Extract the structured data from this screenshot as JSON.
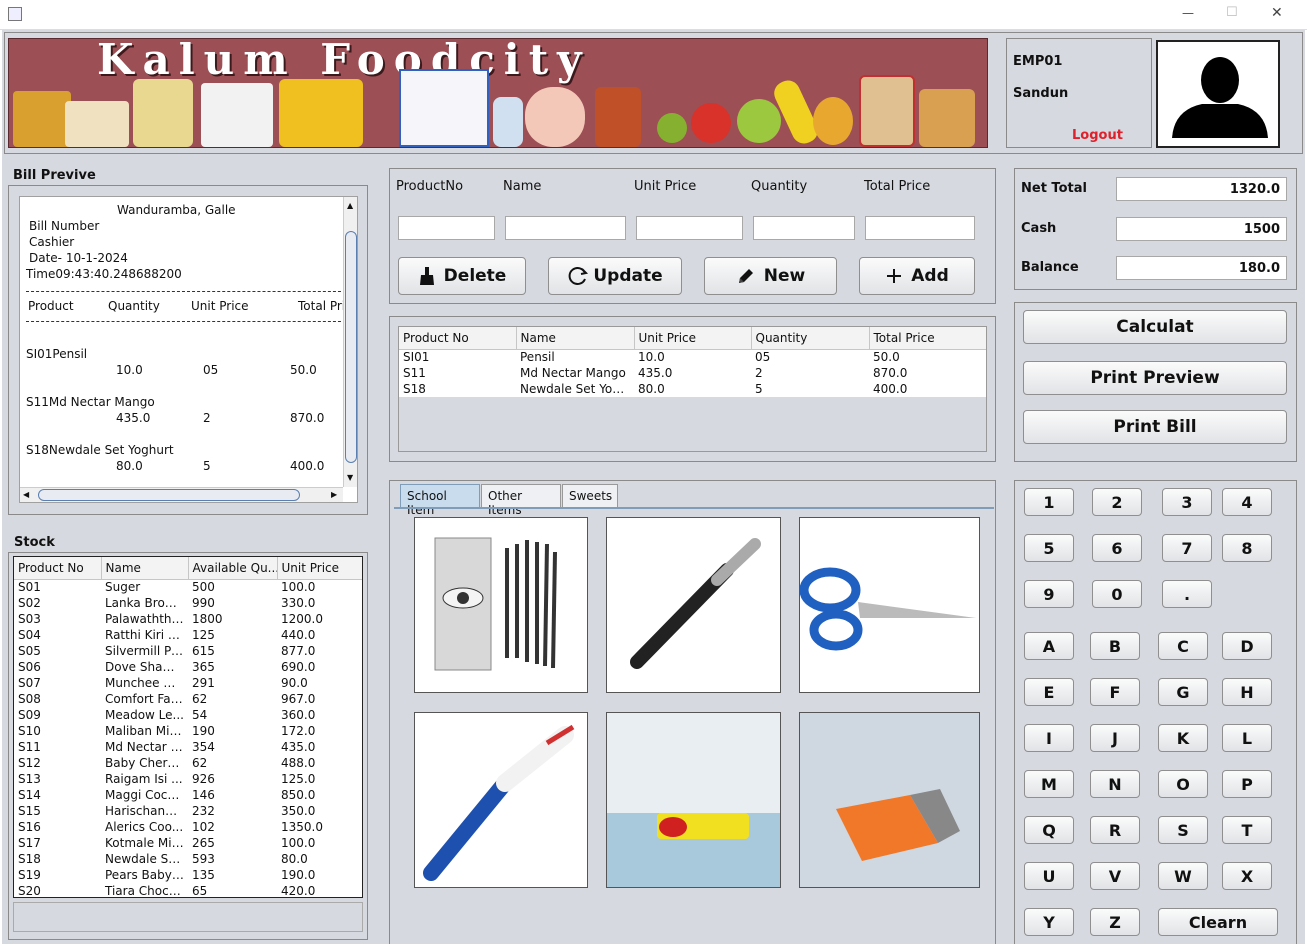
{
  "window": {
    "minimize": "—",
    "maximize": "☐",
    "close": "✕"
  },
  "header": {
    "title": "Kalum Foodcity",
    "emp_id": "EMP01",
    "emp_name": "Sandun",
    "logout": "Logout"
  },
  "bill_preview": {
    "heading": "Bill Previve",
    "address": "Wanduramba, Galle",
    "bill_number": "Bill Number",
    "cashier": "Cashier",
    "date": "Date- 10-1-2024",
    "time": "Time09:43:40.248688200",
    "columns": [
      "Product",
      "Quantity",
      "Unit Price",
      "Total Pri"
    ],
    "items": [
      {
        "name": "SI01Pensil",
        "qty": "10.0",
        "unit": "05",
        "total": "50.0"
      },
      {
        "name": "S11Md Nectar Mango",
        "qty": "435.0",
        "unit": "2",
        "total": "870.0"
      },
      {
        "name": "S18Newdale Set Yoghurt",
        "qty": "80.0",
        "unit": "5",
        "total": "400.0"
      }
    ]
  },
  "entry": {
    "labels": [
      "ProductNo",
      "Name",
      "Unit Price",
      "Quantity",
      "Total Price"
    ],
    "delete": "Delete",
    "update": "Update",
    "new": "New",
    "add": "Add"
  },
  "cart": {
    "columns": [
      "Product No",
      "Name",
      "Unit Price",
      "Quantity",
      "Total Price"
    ],
    "rows": [
      [
        "SI01",
        "Pensil",
        "10.0",
        "05",
        "50.0"
      ],
      [
        "S11",
        "Md Nectar Mango",
        "435.0",
        "2",
        "870.0"
      ],
      [
        "S18",
        "Newdale Set Yog...",
        "80.0",
        "5",
        "400.0"
      ]
    ]
  },
  "totals": {
    "net_total_label": "Net Total",
    "net_total": "1320.0",
    "cash_label": "Cash",
    "cash": "1500",
    "balance_label": "Balance",
    "balance": "180.0"
  },
  "actions": {
    "calculate": "Calculat",
    "print_preview": "Print Preview",
    "print_bill": "Print Bill"
  },
  "stock": {
    "heading": "Stock",
    "columns": [
      "Product No",
      "Name",
      "Available Qu...",
      "Unit Price"
    ],
    "rows": [
      [
        "S01",
        "Suger",
        "500",
        "100.0"
      ],
      [
        "S02",
        "Lanka Brow...",
        "990",
        "330.0"
      ],
      [
        "S03",
        "Palawaththa...",
        "1800",
        "1200.0"
      ],
      [
        "S04",
        "Ratthi Kiri The",
        "125",
        "440.0"
      ],
      [
        "S05",
        "Silvermill Pu...",
        "615",
        "877.0"
      ],
      [
        "S06",
        "Dove Sham...",
        "365",
        "690.0"
      ],
      [
        "S07",
        "Munchee Gi...",
        "291",
        "90.0"
      ],
      [
        "S08",
        "Comfort Fab...",
        "62",
        "967.0"
      ],
      [
        "S09",
        "Meadow Le...",
        "54",
        "360.0"
      ],
      [
        "S10",
        "Maliban Milk...",
        "190",
        "172.0"
      ],
      [
        "S11",
        "Md Nectar M...",
        "354",
        "435.0"
      ],
      [
        "S12",
        "Baby Chera...",
        "62",
        "488.0"
      ],
      [
        "S13",
        "Raigam Isi ...",
        "926",
        "125.0"
      ],
      [
        "S14",
        "Maggi Coco...",
        "146",
        "850.0"
      ],
      [
        "S15",
        "Harischandr...",
        "232",
        "350.0"
      ],
      [
        "S16",
        "Alerics Coo...",
        "102",
        "1350.0"
      ],
      [
        "S17",
        "Kotmale Mil...",
        "265",
        "100.0"
      ],
      [
        "S18",
        "Newdale Se...",
        "593",
        "80.0"
      ],
      [
        "S19",
        "Pears Baby ...",
        "135",
        "190.0"
      ],
      [
        "S20",
        "Tiara Choco...",
        "65",
        "420.0"
      ]
    ]
  },
  "tabs": [
    "School Item",
    "Other Items",
    "Sweets"
  ],
  "products": [
    "pencils-image",
    "pen-image",
    "scissors-image",
    "ballpoint-pen-image",
    "eraser-image",
    "staples-image"
  ],
  "keypad": {
    "digits": [
      "1",
      "2",
      "3",
      "4",
      "5",
      "6",
      "7",
      "8",
      "9",
      "0",
      "."
    ],
    "letters": [
      "A",
      "B",
      "C",
      "D",
      "E",
      "F",
      "G",
      "H",
      "I",
      "J",
      "K",
      "L",
      "M",
      "N",
      "O",
      "P",
      "Q",
      "R",
      "S",
      "T",
      "U",
      "V",
      "W",
      "X",
      "Y",
      "Z"
    ],
    "clear": "Clearn"
  },
  "colors": {
    "banner_bg": "#9c4f55",
    "logout": "#e0202a",
    "app_bg": "#d6d9df"
  }
}
